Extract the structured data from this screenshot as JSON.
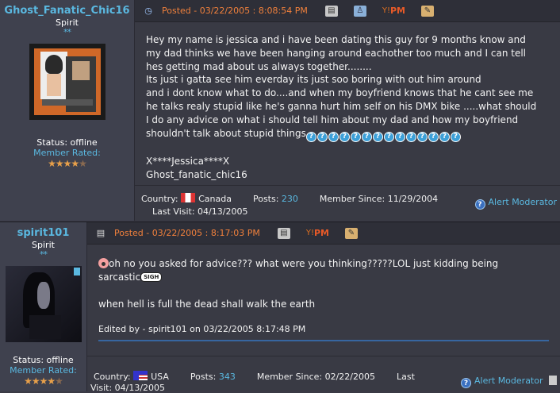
{
  "posts": [
    {
      "username": "Ghost_Fanatic_Chic16",
      "rank": "Spirit",
      "rank_stars": "**",
      "status": "Status: offline",
      "member_rated": "Member Rated:",
      "posted": "Posted - 03/22/2005 :  8:08:54 PM",
      "y_label": "Y!",
      "pm_label": "PM",
      "body_lines": [
        "Hey my name is jessica and i have been dating this guy for 9 months know and",
        "my dad thinks we have been hanging around eachother too much and I can tell",
        "hes getting mad about us always together........",
        "Its just i gatta see him everday its just soo boring with out him around",
        "and i dont know what to do....and when my boyfriend knows that he cant see me",
        "he talks realy stupid like he's ganna hurt him self on his DMX bike .....what should",
        "I do any advice on what i should tell him about my dad and how my boyfriend",
        "shouldn't talk about stupid things"
      ],
      "question_icons": 14,
      "signature": [
        "X****Jessica****X",
        "Ghost_fanatic_chic16"
      ],
      "country_label": "Country:",
      "country": "Canada",
      "posts_label": "Posts:",
      "posts_count": "230",
      "member_since": "Member Since: 11/29/2004",
      "last_visit": "Last Visit: 04/13/2005",
      "alert": "Alert Moderator",
      "stars_filled": 4,
      "stars_total": 5
    },
    {
      "username": "spirit101",
      "rank": "Spirit",
      "rank_stars": "**",
      "status": "Status: offline",
      "member_rated": "Member Rated:",
      "posted": "Posted - 03/22/2005 :  8:17:03 PM",
      "y_label": "Y!",
      "pm_label": "PM",
      "line1": "oh no you asked for advice??? what were you thinking?????LOL just kidding being",
      "line2": "sarcastic",
      "sigh_label": "SIGH",
      "line3": "when hell is full the dead shall walk the earth",
      "edited": "Edited by - spirit101 on 03/22/2005 8:17:48 PM",
      "country_label": "Country:",
      "country": "USA",
      "posts_label": "Posts:",
      "posts_count": "343",
      "member_since": "Member Since: 02/22/2005",
      "last_label": "Last",
      "last_visit": "Visit: 04/13/2005",
      "alert": "Alert Moderator",
      "stars_filled": 4,
      "stars_total": 5
    }
  ],
  "colors": {
    "username": "#5ab8e0",
    "posted": "#f0803c",
    "star": "#e8a04a",
    "link": "#5ab8e0"
  },
  "icons": [
    "clock-icon",
    "profile-icon",
    "user-icon",
    "yahoo-icon",
    "pm-icon",
    "quote-icon",
    "document-icon",
    "flag-icon",
    "help-icon"
  ]
}
